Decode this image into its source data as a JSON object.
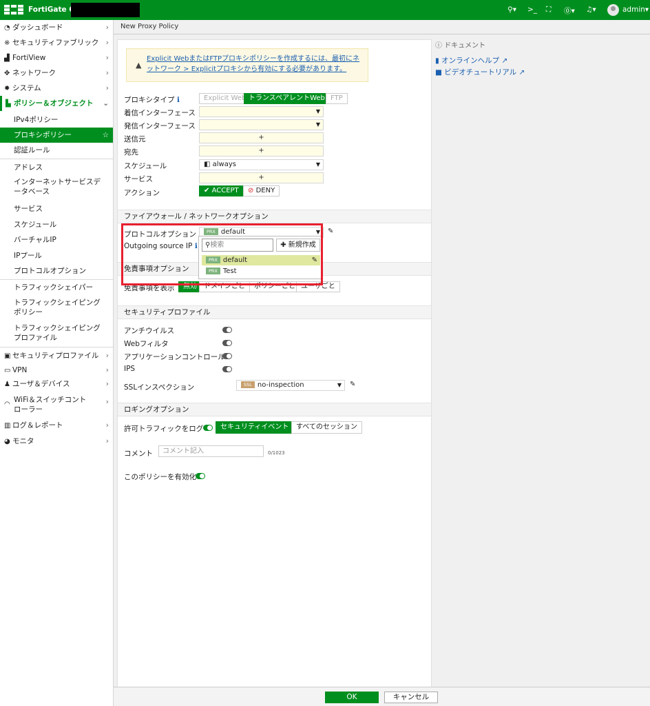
{
  "topbar": {
    "title": "FortiGate 60E",
    "search_icon": "search-icon",
    "cli_label": ">_",
    "fullscreen_icon": "fullscreen-icon",
    "help_icon": "help-icon",
    "bell_icon": "bell-icon",
    "user": "admin",
    "brand_color": "#008f1f"
  },
  "sidebar": {
    "items": [
      {
        "label": "ダッシュボード",
        "chevron": "›"
      },
      {
        "label": "セキュリティファブリック",
        "chevron": "›"
      },
      {
        "label": "FortiView",
        "chevron": "›"
      },
      {
        "label": "ネットワーク",
        "chevron": "›"
      },
      {
        "label": "システム",
        "chevron": "›"
      },
      {
        "label": "ポリシー＆オブジェクト",
        "chevron": "⌄"
      },
      {
        "label": "IPv4ポリシー"
      },
      {
        "label": "プロキシポリシー",
        "star": "☆"
      },
      {
        "label": "認証ルール"
      },
      {
        "label": "アドレス"
      },
      {
        "label": "インターネットサービスデータベース"
      },
      {
        "label": "サービス"
      },
      {
        "label": "スケジュール"
      },
      {
        "label": "バーチャルIP"
      },
      {
        "label": "IPプール"
      },
      {
        "label": "プロトコルオプション"
      },
      {
        "label": "トラフィックシェイパー"
      },
      {
        "label": "トラフィックシェイピングポリシー"
      },
      {
        "label": "トラフィックシェイピングプロファイル"
      },
      {
        "label": "セキュリティプロファイル",
        "chevron": "›"
      },
      {
        "label": "VPN",
        "chevron": "›"
      },
      {
        "label": "ユーザ＆デバイス",
        "chevron": "›"
      },
      {
        "label": "WiFi＆スイッチコントローラー",
        "chevron": "›"
      },
      {
        "label": "ログ＆レポート",
        "chevron": "›"
      },
      {
        "label": "モニタ",
        "chevron": "›"
      }
    ]
  },
  "page": {
    "breadcrumb": "New Proxy Policy",
    "warning": "Explicit WebまたはFTPプロキシポリシーを作成するには、最初にネットワーク > Explicitプロキシから有効にする必要があります。"
  },
  "form": {
    "proxy_type_label": "プロキシタイプ",
    "proxy_types": [
      "Explicit Web",
      "トランスペアレントWeb",
      "FTP"
    ],
    "in_if_label": "着信インターフェース",
    "out_if_label": "発信インターフェース",
    "src_label": "送信元",
    "dst_label": "宛先",
    "schedule_label": "スケジュール",
    "schedule_value": "always",
    "service_label": "サービス",
    "action_label": "アクション",
    "accept": "ACCEPT",
    "deny": "DENY",
    "plus": "+"
  },
  "fw_section": {
    "title": "ファイアウォール / ネットワークオプション",
    "protocol_label": "プロトコルオプション",
    "protocol_value": "default",
    "outgoing_label": "Outgoing source IP",
    "disclaimer_section": "免責事項オプション",
    "disclaimer_label": "免責事項を表示",
    "disclaimer_options": [
      "無効",
      "ドメインごと",
      "ポリシーごと",
      "ユーザごと"
    ]
  },
  "dropdown": {
    "search_placeholder": "検索",
    "new_button": "新規作成",
    "options": [
      "default",
      "Test"
    ],
    "badge": "PRX"
  },
  "security": {
    "title": "セキュリティプロファイル",
    "items": [
      "アンチウイルス",
      "Webフィルタ",
      "アプリケーションコントロール",
      "IPS"
    ],
    "ssl_label": "SSLインスペクション",
    "ssl_value": "no-inspection",
    "ssl_badge": "SSL"
  },
  "logging": {
    "title": "ロギングオプション",
    "log_label": "許可トラフィックをログ",
    "options": [
      "セキュリティイベント",
      "すべてのセッション"
    ],
    "comment_label": "コメント",
    "comment_placeholder": "コメント記入",
    "counter": "0/1023",
    "enable_label": "このポリシーを有効化"
  },
  "right_panel": {
    "title": "ドキュメント",
    "links": [
      "オンラインヘルプ",
      "ビデオチュートリアル"
    ]
  },
  "footer": {
    "ok": "OK",
    "cancel": "キャンセル"
  }
}
